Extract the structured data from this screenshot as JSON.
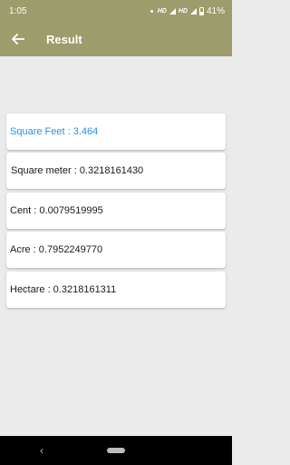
{
  "status_bar": {
    "time": "1:05",
    "network_1": "HD",
    "network_2": "HD",
    "battery": "41%"
  },
  "app_bar": {
    "title": "Result"
  },
  "results": [
    {
      "text": "Square Feet : 3.464",
      "highlight": true
    },
    {
      "text": "Square meter : 0.3218161430",
      "highlight": false
    },
    {
      "text": "Cent : 0.0079519995",
      "highlight": false
    },
    {
      "text": "Acre : 0.7952249770",
      "highlight": false
    },
    {
      "text": "Hectare : 0.3218161311",
      "highlight": false
    }
  ],
  "colors": {
    "app_bar": "#9c9c6c",
    "background": "#ebebeb",
    "highlight_text": "#2a8fe8"
  },
  "icons": {
    "back": "arrow-left-icon",
    "nav_back": "nav-back-icon",
    "nav_home": "home-pill-icon"
  }
}
